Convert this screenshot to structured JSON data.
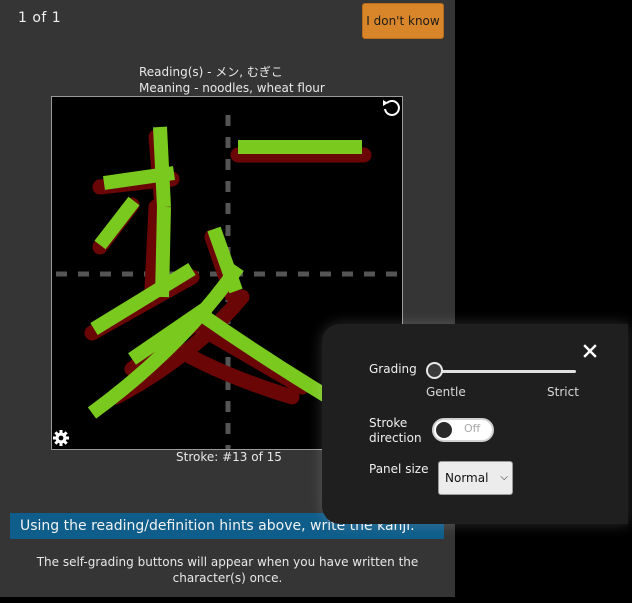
{
  "header": {
    "counter": "1 of 1",
    "dont_know_label": "I don't know"
  },
  "hints": {
    "reading": "Reading(s) - メン, むぎこ",
    "meaning": "Meaning - noodles, wheat flour"
  },
  "canvas": {
    "reset_icon": "reset-icon",
    "settings_icon": "gear-icon",
    "colors": {
      "stroke": "#7ac91e",
      "outline": "#6b0606",
      "guides": "#555555",
      "background": "#000000"
    }
  },
  "stroke_count": "Stroke: #13 of 15",
  "instruction": "Using the reading/definition hints above, write the kanji.",
  "self_grade_note": "The self-grading buttons will appear when you have written the character(s) once.",
  "settings": {
    "close_icon": "close-icon",
    "grading": {
      "label": "Grading",
      "min_label": "Gentle",
      "max_label": "Strict",
      "value": 0
    },
    "stroke_direction": {
      "label": "Stroke direction",
      "state": "Off"
    },
    "panel_size": {
      "label": "Panel size",
      "selected": "Normal"
    }
  },
  "colors": {
    "panel_bg": "#353535",
    "accent_button": "#d9862a",
    "instruction_bg": "#0f5d8a",
    "settings_bg": "#1f1f1f"
  }
}
